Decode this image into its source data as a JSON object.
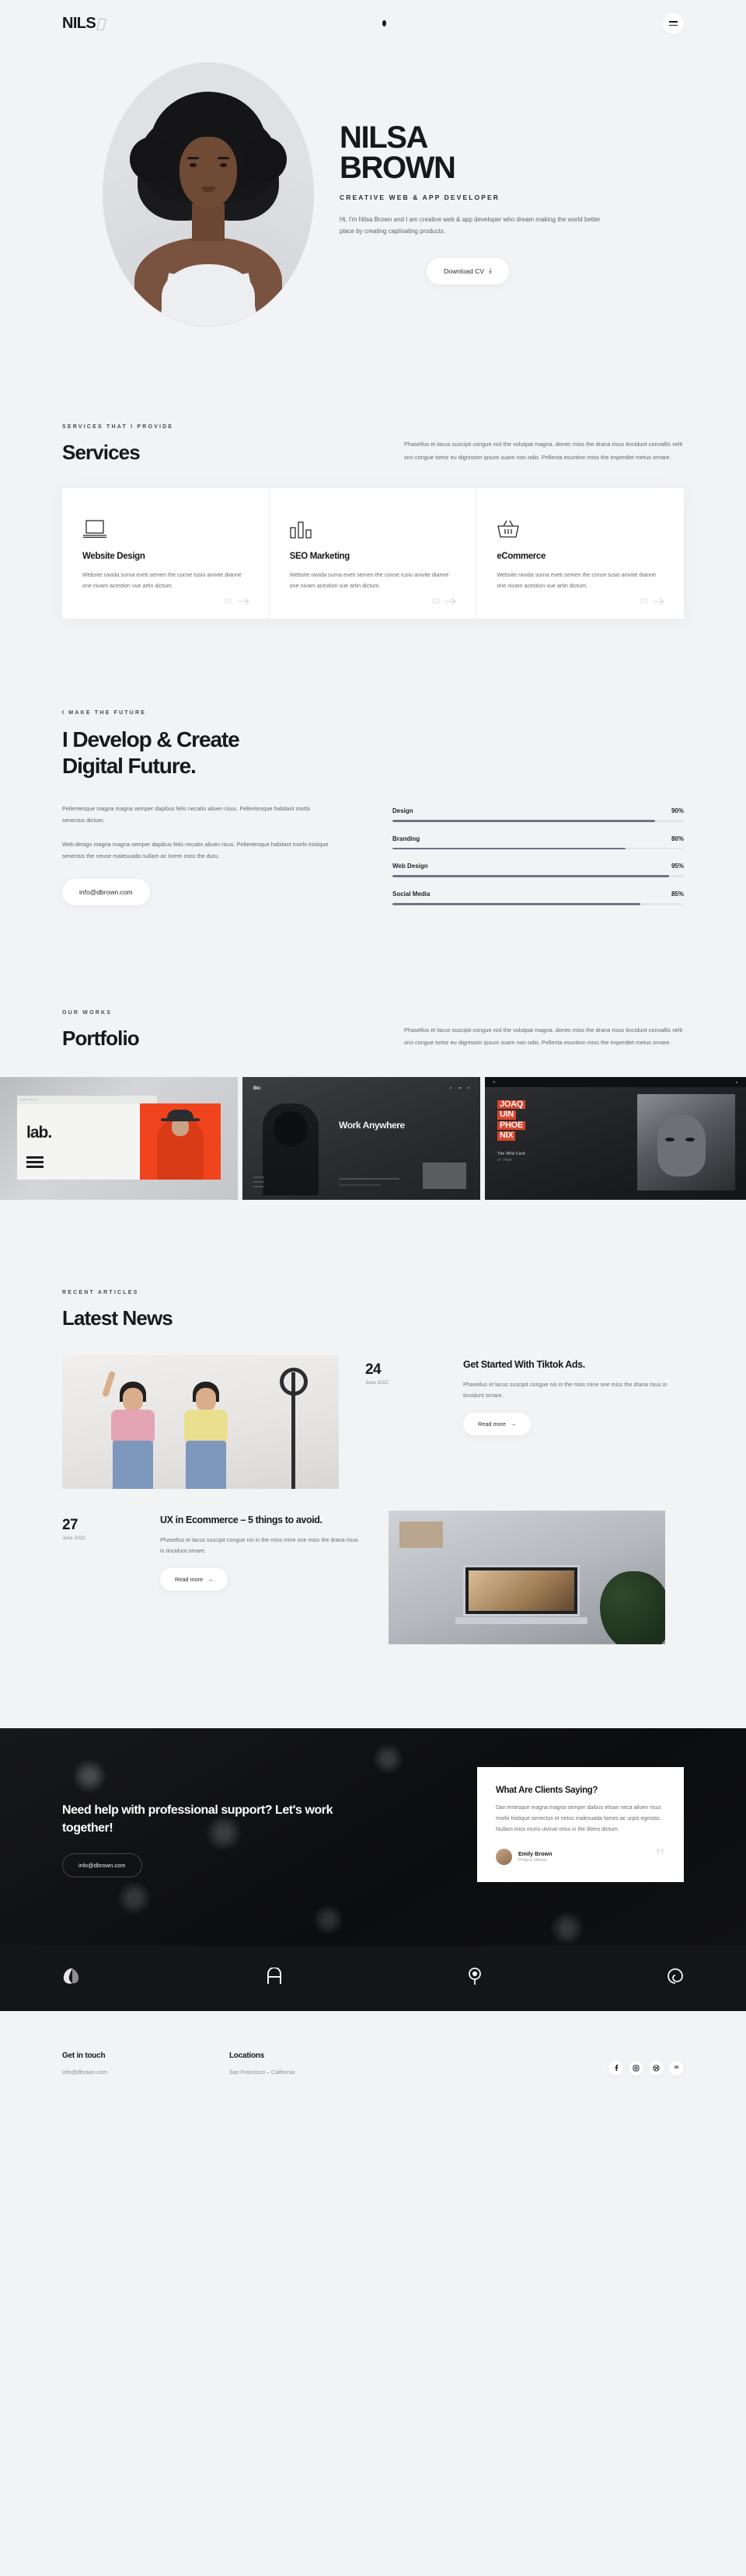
{
  "header": {
    "logo_text": "NILS",
    "logo_mark_icon": "slash-mark-icon",
    "dot_icon": "nav-dot-icon",
    "menu_icon": "hamburger-menu-icon"
  },
  "hero": {
    "name_line1": "NILSA",
    "name_line2": "BROWN",
    "role": "CREATIVE WEB & APP DEVELOPER",
    "description": "Hi, I'm Nilsa Brown and I am creative web & app developer who dream making the world better place by creating captivating products.",
    "cta_label": "Download CV",
    "cta_icon": "download-icon",
    "portrait_alt": "portrait-photo"
  },
  "services": {
    "kicker": "SERVICES THAT I PROVIDE",
    "title": "Services",
    "lead": "Phasellus et lacus suscipit congue nisl the volutpat magna. donec miss the drana risus tincidunt convallis velit orci congue tortor eu dignissim ipsum suam non odio. Pellenta esuntion miss the imperdiet metus ornare.",
    "cards": [
      {
        "icon": "laptop-icon",
        "title": "Website Design",
        "body": "Website ravida surna eveti semen the conse tusio anivite dianne one nivam acestion vue artin dictum.",
        "number": "01"
      },
      {
        "icon": "bar-chart-icon",
        "title": "SEO Marketing",
        "body": "Website ravida surna eveti semen the conse tusio anivite dianne one nivam acestion vue artin dictum.",
        "number": "02"
      },
      {
        "icon": "shopping-basket-icon",
        "title": "eCommerce",
        "body": "Website ravida surna eveti semen the conse tusio anivite dianne one nivam acestion vue artin dictum.",
        "number": "03"
      }
    ]
  },
  "develop": {
    "kicker": "I MAKE THE FUTURE",
    "title_line1": "I Develop & Create",
    "title_line2": "Digital Future.",
    "paragraph1": "Pellentesque magna magna semper dapibus felis necatin aliuen risus. Pellentesque habitant morbi senectus dictum.",
    "paragraph2": "Web design magna magna semper dapibus felis necatin aliuen risus. Pellentesque habitant morbi tristique senectus the neuse malesuada nullam ac lorem miss the duru.",
    "email": "info@dbrown.com",
    "skills": [
      {
        "name": "Design",
        "value": "90%",
        "percent": 90
      },
      {
        "name": "Branding",
        "value": "80%",
        "percent": 80
      },
      {
        "name": "Web Design",
        "value": "95%",
        "percent": 95
      },
      {
        "name": "Social Media",
        "value": "85%",
        "percent": 85
      }
    ]
  },
  "portfolio": {
    "kicker": "OUR WORKS",
    "title": "Portfolio",
    "lead": "Phasellus et lacus suscipit congue nisl the volutpat magna. donec miss the drana risus tincidunt convallis velit orci congue tortor eu dignissim ipsum suam non odio. Pellenta esuntion miss the imperdiet metus ornare.",
    "items": [
      {
        "name": "portfolio-item-lab",
        "label": "lab.",
        "meta": "PORTFOLIO"
      },
      {
        "name": "portfolio-item-work",
        "label": "Work Anywhere",
        "meta": "Bio"
      },
      {
        "name": "portfolio-item-joaquin",
        "label_1": "JOAQ",
        "label_2": "UIN",
        "label_3": "PHOE",
        "label_4": "NIX",
        "sub": "The Wild Card",
        "sub2": "of ' FEW'"
      }
    ]
  },
  "news": {
    "kicker": "RECENT ARTICLES",
    "title": "Latest News",
    "articles": [
      {
        "day": "24",
        "month": "June 2022",
        "title": "Get Started With Tiktok Ads.",
        "excerpt": "Phasellus et lacus suscipit congue nis in the miss mine one miss the drana risus in tincidunt ornare.",
        "read_label": "Read more",
        "read_icon": "arrow-right-icon",
        "image_name": "article-image-tiktok"
      },
      {
        "day": "27",
        "month": "June 2022",
        "title": "UX in Ecommerce – 5 things to avoid.",
        "excerpt": "Phasellus et lacus suscipit congue nis in the miss mine one miss the drana risus in tincidunt ornare.",
        "read_label": "Read more",
        "read_icon": "arrow-right-icon",
        "image_name": "article-image-ux"
      }
    ]
  },
  "cta": {
    "title": "Need help with professional support? Let's work together!",
    "email": "info@dbrown.com",
    "testimonial": {
      "title": "What Are Clients Saying?",
      "body": "Dan entesque magna magna semper daibus elisan neca aliuen risus morbi tristique senectus et netus malesuada fames ac urpis egestas. Nullam miss muris ulvinar miss in the libero dictum.",
      "author": "Emily Brown",
      "role": "Project Owner",
      "quote_mark": "”"
    }
  },
  "brands": [
    {
      "name": "brand-logo-shell",
      "icon": "shell-icon"
    },
    {
      "name": "brand-logo-arch",
      "icon": "arch-icon"
    },
    {
      "name": "brand-logo-compass",
      "icon": "compass-icon"
    },
    {
      "name": "brand-logo-spiral",
      "icon": "spiral-icon"
    }
  ],
  "footer": {
    "contact_heading": "Get in touch",
    "contact_value": "info@dbrown.com",
    "locations_heading": "Locations",
    "locations_value": "San Francisco – California",
    "socials": [
      {
        "name": "facebook-icon",
        "glyph": "f"
      },
      {
        "name": "instagram-icon",
        "glyph": "□"
      },
      {
        "name": "dribbble-icon",
        "glyph": "●"
      },
      {
        "name": "linkedin-icon",
        "glyph": "in"
      }
    ]
  },
  "colors": {
    "bg": "#f2f3f5",
    "ink": "#17181c",
    "muted": "#6a6c72",
    "dark": "#111214",
    "accent_orange": "#f0441e",
    "bar": "#6f7382"
  }
}
